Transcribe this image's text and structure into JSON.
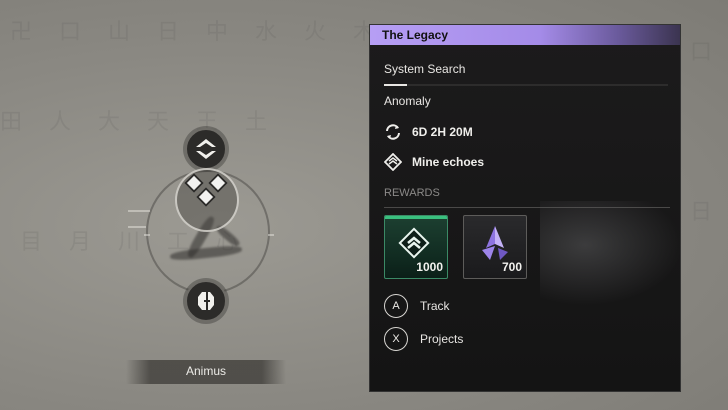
{
  "map": {
    "location_label": "Animus",
    "nodes": [
      "top-node",
      "selected-node",
      "bottom-node"
    ]
  },
  "panel": {
    "title": "The Legacy",
    "system_search": "System Search",
    "system_search_progress": 0.08,
    "anomaly": "Anomaly",
    "timer": {
      "icon": "refresh-icon",
      "text": "6D 2H 20M"
    },
    "objective": {
      "icon": "echo-diamond-icon",
      "text": "Mine echoes"
    },
    "rewards_label": "REWARDS",
    "rewards": [
      {
        "icon": "chevron-up-diamond-icon",
        "quantity": "1000",
        "accent": "#39c07e"
      },
      {
        "icon": "purple-shard-icon",
        "quantity": "700",
        "accent": "#a78bfa"
      }
    ],
    "actions": [
      {
        "button": "A",
        "label": "Track"
      },
      {
        "button": "X",
        "label": "Projects"
      }
    ]
  },
  "colors": {
    "header_accent": "#b69ef4",
    "reward_green": "#39c07e",
    "shard_purple": "#a78bfa"
  }
}
